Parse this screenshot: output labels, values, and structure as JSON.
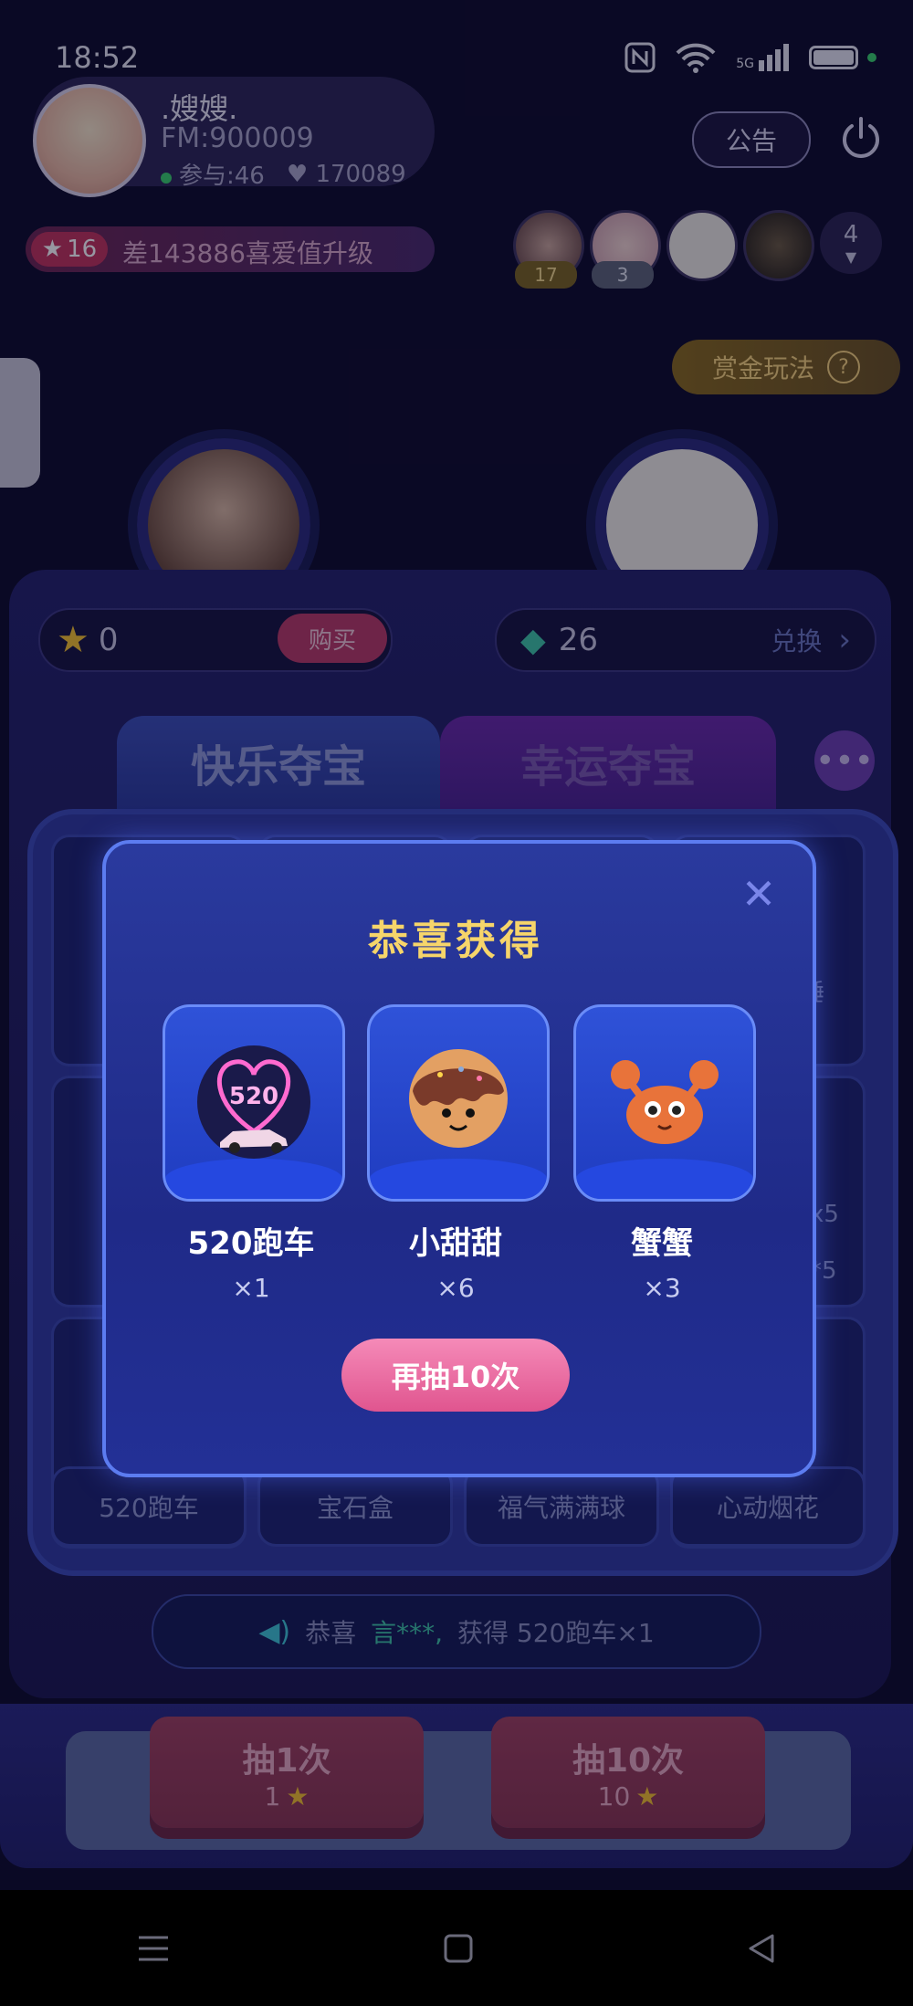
{
  "status_bar": {
    "time": "18:52",
    "network_label": "5G"
  },
  "header": {
    "username": ".嫂嫂.",
    "fm_id": "FM:900009",
    "participants": "参与:46",
    "likes": "170089",
    "notice_label": "公告",
    "level_number": "16",
    "level_text": "差143886喜爱值升级"
  },
  "audience": {
    "badges": [
      "17",
      "3"
    ],
    "count": "4"
  },
  "bounty_label": "赏金玩法",
  "wallet": {
    "stars": "0",
    "buy_label": "购买",
    "gems": "26",
    "exchange_label": "兑换"
  },
  "tabs": [
    {
      "label": "快乐夺宝"
    },
    {
      "label": "幸运夺宝"
    }
  ],
  "grid_labels": [
    "520跑车",
    "宝石盒",
    "福气满满球",
    "心动烟花"
  ],
  "grid_partial": {
    "right_mid_a": "x5",
    "right_mid_b": "*5",
    "right_top": "锤"
  },
  "ticker": {
    "prefix": "恭喜",
    "user": "言***,",
    "text": "获得 520跑车×1"
  },
  "draw_buttons": [
    {
      "label": "抽1次",
      "cost": "1"
    },
    {
      "label": "抽10次",
      "cost": "10"
    }
  ],
  "modal": {
    "title": "恭喜获得",
    "prizes": [
      {
        "name": "520跑车",
        "qty": "×1",
        "icon": "sports-car-heart-icon",
        "badge": "520"
      },
      {
        "name": "小甜甜",
        "qty": "×6",
        "icon": "donut-icon"
      },
      {
        "name": "蟹蟹",
        "qty": "×3",
        "icon": "crab-icon"
      }
    ],
    "again_label": "再抽10次"
  },
  "colors": {
    "accent_gold": "#f6d56a",
    "pink_button": "#e0558f",
    "modal_border": "#5c7cf0"
  }
}
